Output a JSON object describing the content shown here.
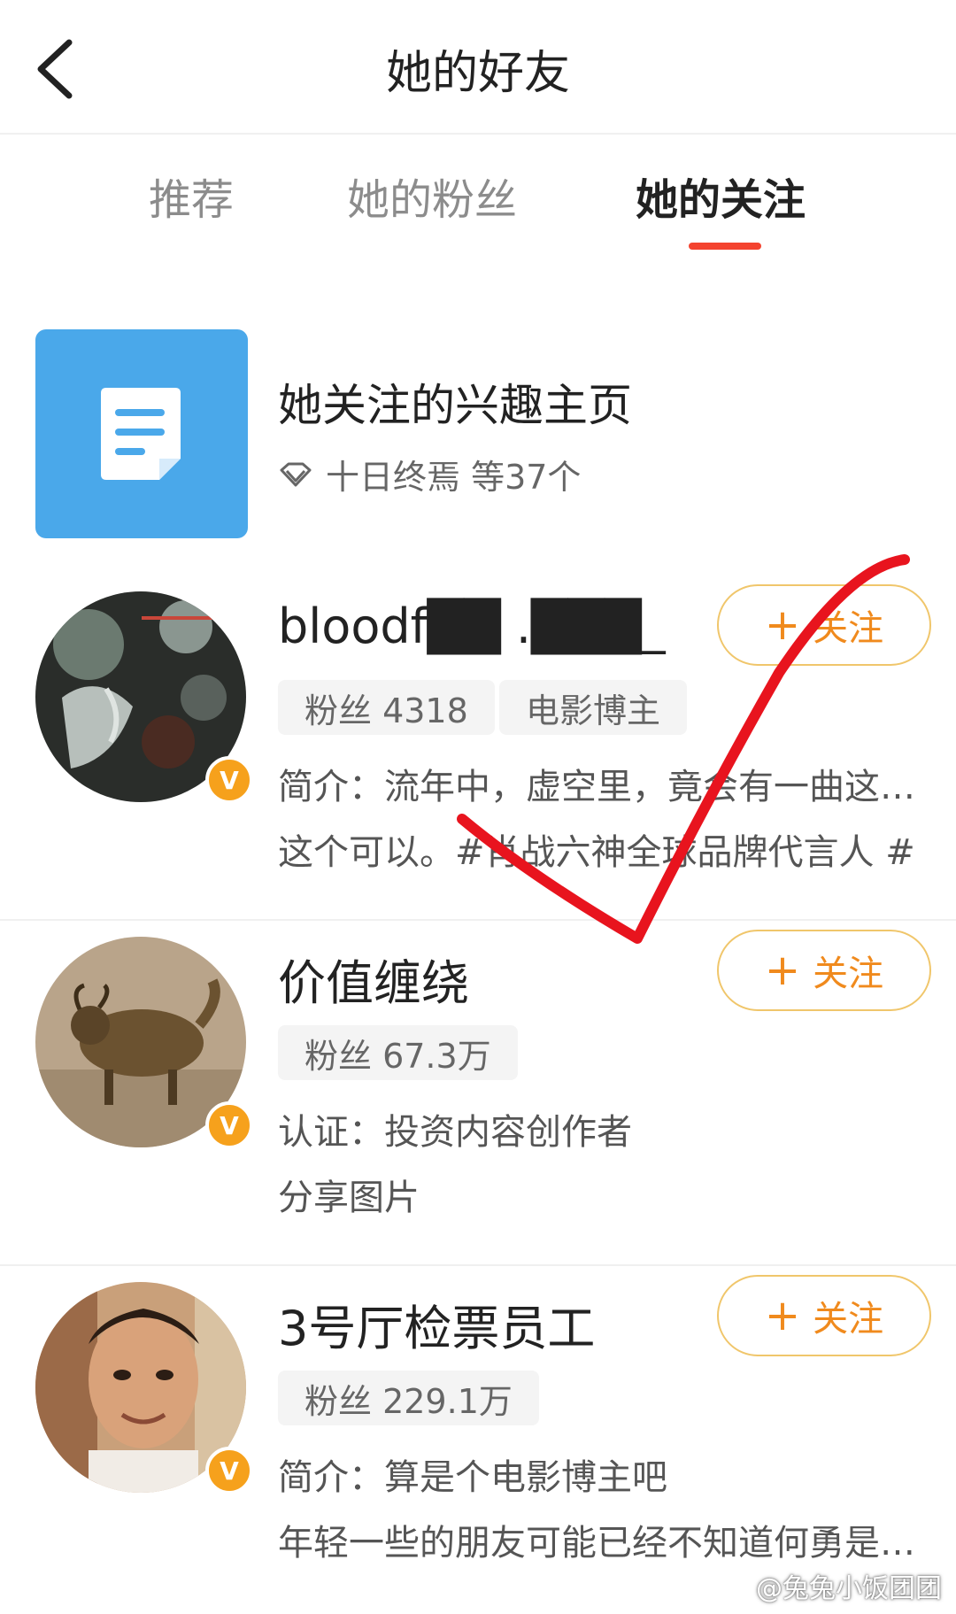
{
  "header": {
    "title": "她的好友"
  },
  "tabs": [
    {
      "label": "推荐",
      "active": false
    },
    {
      "label": "她的粉丝",
      "active": false
    },
    {
      "label": "她的关注",
      "active": true
    }
  ],
  "interest": {
    "title": "她关注的兴趣主页",
    "subtitle": "十日终焉 等37个"
  },
  "users": [
    {
      "name": "bloodf██ .███_",
      "tags": [
        "粉丝 4318",
        "电影博主"
      ],
      "line1": "简介：流年中，虚空里，竟会有一曲这…",
      "line2": "这个可以。#肖战六神全球品牌代言人 #",
      "follow_label": "关注"
    },
    {
      "name": "价值缠绕",
      "tags": [
        "粉丝 67.3万"
      ],
      "line1": "认证：投资内容创作者",
      "line2": "分享图片",
      "follow_label": "关注"
    },
    {
      "name": "3号厅检票员工",
      "tags": [
        "粉丝 229.1万"
      ],
      "line1": "简介：算是个电影博主吧",
      "line2": "年轻一些的朋友可能已经不知道何勇是…",
      "follow_label": "关注"
    }
  ],
  "badge_letter": "V",
  "watermark": "@兔兔小饭团团",
  "colors": {
    "accent": "#f4432f",
    "follow": "#f08a1d",
    "badge": "#f6a11c",
    "interest_tile": "#4aa8ea",
    "check_mark": "#e8141e"
  },
  "icons": {
    "back": "chevron-left-icon",
    "document": "document-icon",
    "diamond": "diamond-icon",
    "plus": "plus-icon"
  }
}
